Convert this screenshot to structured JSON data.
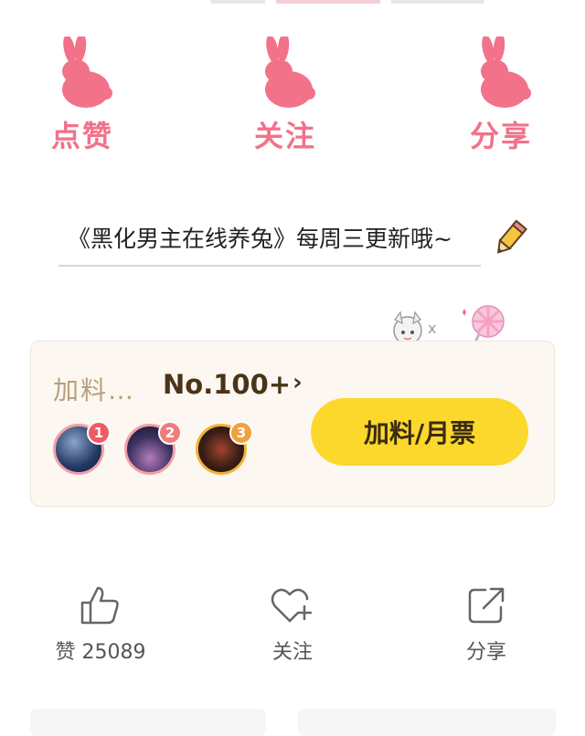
{
  "rabbits": [
    {
      "label": "点赞"
    },
    {
      "label": "关注"
    },
    {
      "label": "分享"
    }
  ],
  "notice": {
    "text": "《黑化男主在线养兔》每周三更新哦~"
  },
  "deco": {
    "close": "x"
  },
  "support": {
    "title": "加料…",
    "rank": "No.100+",
    "chevron": "›",
    "ranks": [
      "1",
      "2",
      "3"
    ],
    "button": "加料/月票"
  },
  "actions": [
    {
      "label": "赞 25089"
    },
    {
      "label": "关注"
    },
    {
      "label": "分享"
    }
  ],
  "colors": {
    "rabbit": "#f2728a",
    "button": "#fbd82b",
    "card": "#fdf7f1",
    "rank_text": "#4a3418"
  }
}
